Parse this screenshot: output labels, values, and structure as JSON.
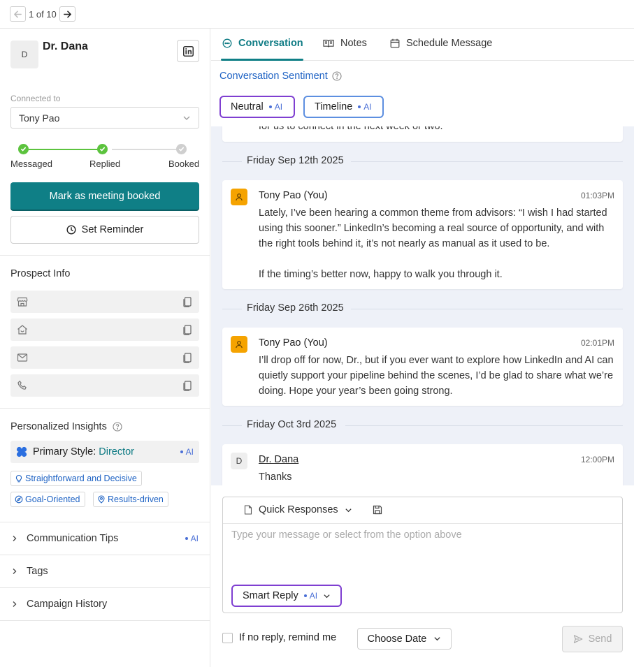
{
  "pager": {
    "text": "1 of 10"
  },
  "prospect": {
    "initial": "D",
    "name": "Dr. Dana",
    "connected_label": "Connected to",
    "connected_value": "Tony Pao"
  },
  "stepper": {
    "steps": [
      {
        "label": "Messaged",
        "done": true
      },
      {
        "label": "Replied",
        "done": true
      },
      {
        "label": "Booked",
        "done": false
      }
    ]
  },
  "actions": {
    "mark_booked": "Mark as meeting booked",
    "set_reminder": "Set Reminder"
  },
  "prospect_info": {
    "title": "Prospect Info",
    "rows": [
      {
        "icon": "store-icon"
      },
      {
        "icon": "home-icon"
      },
      {
        "icon": "mail-icon"
      },
      {
        "icon": "phone-icon"
      }
    ]
  },
  "insights": {
    "title": "Personalized Insights",
    "style_prefix": "Primary Style:",
    "style_value": "Director",
    "ai_label": "AI",
    "chips": [
      "Straightforward and Decisive",
      "Goal-Oriented",
      "Results-driven"
    ]
  },
  "accordions": {
    "communication": "Communication Tips",
    "tags": "Tags",
    "campaign": "Campaign History"
  },
  "tabs": {
    "conversation": "Conversation",
    "notes": "Notes",
    "schedule": "Schedule Message"
  },
  "sentiment": {
    "title": "Conversation Sentiment",
    "pills": [
      "Neutral",
      "Timeline"
    ],
    "ai_label": "AI"
  },
  "thread": {
    "partial_text": "for us to connect in the next week or two.",
    "groups": [
      {
        "date": "Friday Sep 12th 2025",
        "sender": "Tony Pao (You)",
        "time": "01:03PM",
        "p1": "Lately, I’ve been hearing a common theme from advisors: “I wish I had started using this sooner.” LinkedIn’s becoming a real source of opportunity, and with the right tools behind it, it’s not nearly as manual as it used to be.",
        "p2": "If the timing’s better now, happy to walk you through it."
      },
      {
        "date": "Friday Sep 26th 2025",
        "sender": "Tony Pao (You)",
        "time": "02:01PM",
        "p1": "I’ll drop off for now, Dr., but if you ever want to explore how LinkedIn and AI can quietly support your pipeline behind the scenes, I’d be glad to share what we’re doing. Hope your year’s been going strong."
      },
      {
        "date": "Friday Oct 3rd 2025",
        "sender": "Dr. Dana",
        "initial": "D",
        "time": "12:00PM",
        "p1": "Thanks"
      }
    ]
  },
  "composer": {
    "quick_responses": "Quick Responses",
    "placeholder": "Type your message or select from the option above",
    "smart_reply": "Smart Reply",
    "ai_label": "AI"
  },
  "footer": {
    "remind_label": "If no reply, remind me",
    "choose_date": "Choose Date",
    "send": "Send"
  },
  "colors": {
    "primary": "#0f7f86",
    "link": "#1f63c4",
    "ai_border": "#7f3fd1",
    "step_done": "#5cc33e",
    "thread_bg": "#eef1f8",
    "avatar_you": "#f5a300"
  }
}
